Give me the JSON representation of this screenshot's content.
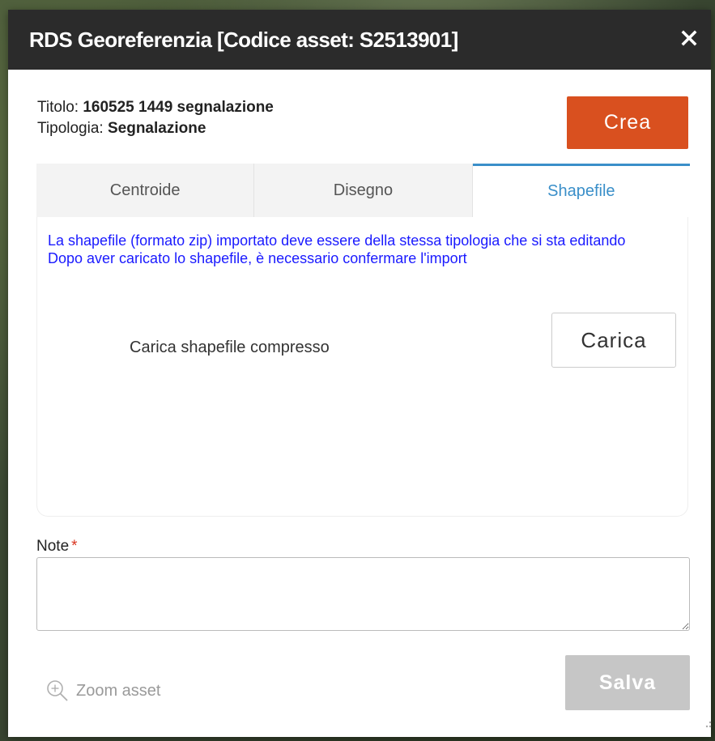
{
  "dialog": {
    "title": "RDS Georeferenzia [Codice asset: S2513901]",
    "close_icon": "close-icon"
  },
  "info": {
    "titolo_label": "Titolo:",
    "titolo_value": "160525 1449 segnalazione",
    "tipologia_label": "Tipologia:",
    "tipologia_value": "Segnalazione"
  },
  "actions": {
    "crea_label": "Crea",
    "crea_color": "#d9501f"
  },
  "tabs": [
    {
      "label": "Centroide",
      "active": false
    },
    {
      "label": "Disegno",
      "active": false
    },
    {
      "label": "Shapefile",
      "active": true
    }
  ],
  "shapefile": {
    "notice_line1": "La shapefile (formato zip) importato deve essere della stessa tipologia che si sta editando",
    "notice_line2": "Dopo aver caricato lo shapefile, è necessario confermare l'import",
    "upload_label": "Carica shapefile compresso",
    "upload_button": "Carica"
  },
  "note": {
    "label": "Note",
    "required_marker": "*",
    "value": ""
  },
  "footer": {
    "zoom_label": "Zoom asset",
    "zoom_icon": "zoom-in-icon",
    "salva_label": "Salva"
  },
  "colors": {
    "accent": "#3a8fc9",
    "notice_text": "#1a1aff",
    "title_bar": "#2b2b2b"
  }
}
